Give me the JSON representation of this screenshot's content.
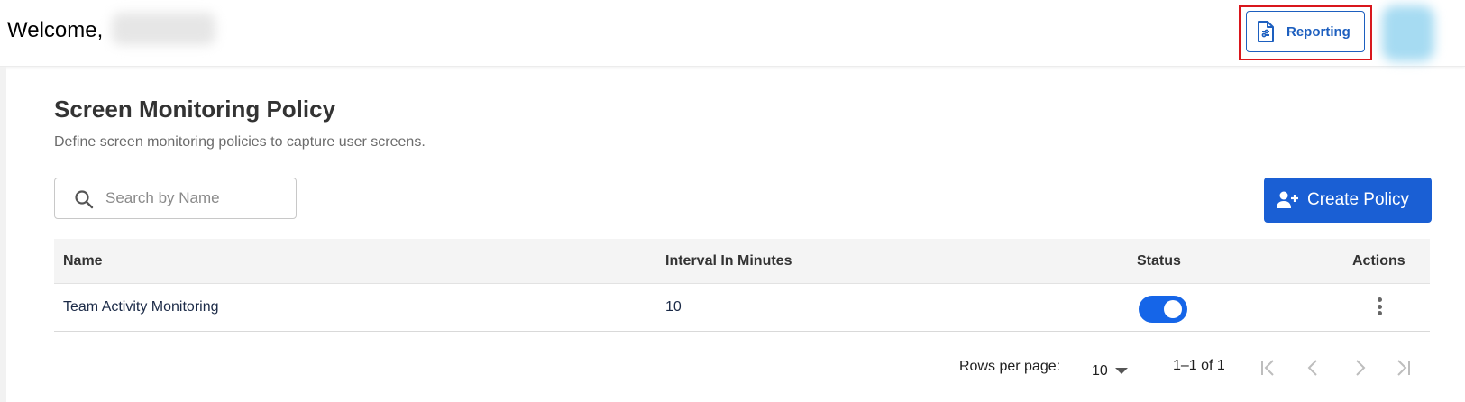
{
  "header": {
    "welcome": "Welcome,",
    "reporting_label": "Reporting"
  },
  "page": {
    "title": "Screen Monitoring Policy",
    "subtitle": "Define screen monitoring policies to capture user screens."
  },
  "search": {
    "placeholder": "Search by Name",
    "value": ""
  },
  "create_button": {
    "label": "Create Policy"
  },
  "table": {
    "columns": [
      "Name",
      "Interval In Minutes",
      "Status",
      "Actions"
    ],
    "rows": [
      {
        "name": "Team Activity Monitoring",
        "interval": "10",
        "status_enabled": true
      }
    ]
  },
  "pagination": {
    "rows_per_page_label": "Rows per page:",
    "rows_per_page_value": "10",
    "range": "1–1 of 1"
  },
  "colors": {
    "accent": "#1a5fd4",
    "toggle_on": "#1565e8",
    "highlight": "#d9161c",
    "outline_button": "#1d5fbf"
  },
  "icons": [
    "document-report-icon",
    "search-icon",
    "add-user-icon",
    "chevron-down-icon",
    "first-page-icon",
    "prev-page-icon",
    "next-page-icon",
    "last-page-icon",
    "more-vertical-icon"
  ]
}
